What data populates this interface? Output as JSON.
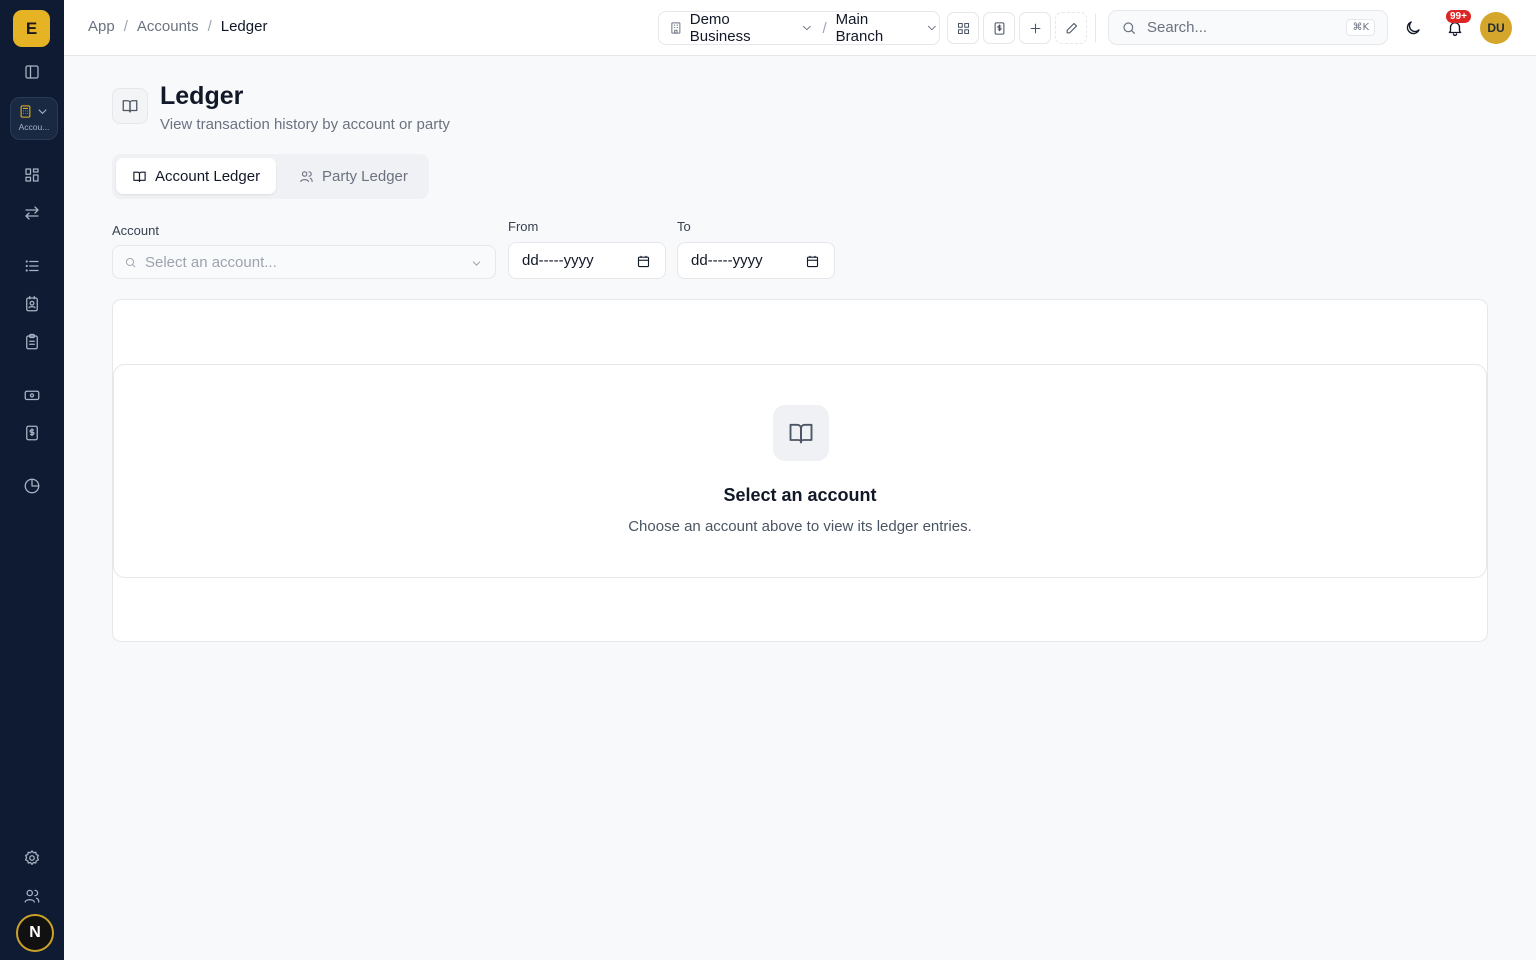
{
  "sidebar": {
    "logo_letter": "E",
    "module_label": "Accou...",
    "user_initial": "N"
  },
  "breadcrumb": {
    "items": [
      "App",
      "Accounts",
      "Ledger"
    ],
    "separator": "/"
  },
  "business": {
    "name": "Demo Business",
    "branch": "Main Branch"
  },
  "search": {
    "placeholder": "Search...",
    "shortcut": "⌘K"
  },
  "notifications": {
    "count": "99+"
  },
  "user": {
    "initials": "DU"
  },
  "page": {
    "title": "Ledger",
    "subtitle": "View transaction history by account or party"
  },
  "tabs": [
    {
      "label": "Account Ledger",
      "active": true
    },
    {
      "label": "Party Ledger",
      "active": false
    }
  ],
  "filters": {
    "account_label": "Account",
    "account_placeholder": "Select an account...",
    "from_label": "From",
    "from_value": "dd-----yyyy",
    "to_label": "To",
    "to_value": "dd-----yyyy"
  },
  "empty_state": {
    "title": "Select an account",
    "description": "Choose an account above to view its ledger entries."
  },
  "colors": {
    "sidebar_bg": "#0e1b33",
    "accent": "#e6b325",
    "badge": "#dc2626"
  }
}
